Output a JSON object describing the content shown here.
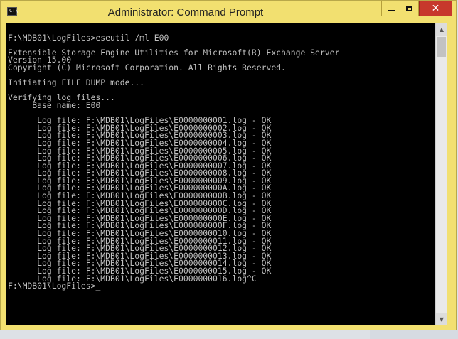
{
  "window": {
    "title": "Administrator: Command Prompt",
    "icon_label": "C:\\"
  },
  "controls": {
    "minimize": "minimize",
    "maximize": "maximize",
    "close": "✕"
  },
  "console_lines": [
    "",
    "F:\\MDB01\\LogFiles>eseutil /ml E00",
    "",
    "Extensible Storage Engine Utilities for Microsoft(R) Exchange Server",
    "Version 15.00",
    "Copyright (C) Microsoft Corporation. All Rights Reserved.",
    "",
    "Initiating FILE DUMP mode...",
    "",
    "Verifying log files...",
    "     Base name: E00",
    "",
    "      Log file: F:\\MDB01\\LogFiles\\E0000000001.log - OK",
    "      Log file: F:\\MDB01\\LogFiles\\E0000000002.log - OK",
    "      Log file: F:\\MDB01\\LogFiles\\E0000000003.log - OK",
    "      Log file: F:\\MDB01\\LogFiles\\E0000000004.log - OK",
    "      Log file: F:\\MDB01\\LogFiles\\E0000000005.log - OK",
    "      Log file: F:\\MDB01\\LogFiles\\E0000000006.log - OK",
    "      Log file: F:\\MDB01\\LogFiles\\E0000000007.log - OK",
    "      Log file: F:\\MDB01\\LogFiles\\E0000000008.log - OK",
    "      Log file: F:\\MDB01\\LogFiles\\E0000000009.log - OK",
    "      Log file: F:\\MDB01\\LogFiles\\E000000000A.log - OK",
    "      Log file: F:\\MDB01\\LogFiles\\E000000000B.log - OK",
    "      Log file: F:\\MDB01\\LogFiles\\E000000000C.log - OK",
    "      Log file: F:\\MDB01\\LogFiles\\E000000000D.log - OK",
    "      Log file: F:\\MDB01\\LogFiles\\E000000000E.log - OK",
    "      Log file: F:\\MDB01\\LogFiles\\E000000000F.log - OK",
    "      Log file: F:\\MDB01\\LogFiles\\E0000000010.log - OK",
    "      Log file: F:\\MDB01\\LogFiles\\E0000000011.log - OK",
    "      Log file: F:\\MDB01\\LogFiles\\E0000000012.log - OK",
    "      Log file: F:\\MDB01\\LogFiles\\E0000000013.log - OK",
    "      Log file: F:\\MDB01\\LogFiles\\E0000000014.log - OK",
    "      Log file: F:\\MDB01\\LogFiles\\E0000000015.log - OK",
    "      Log file: F:\\MDB01\\LogFiles\\E0000000016.log^C"
  ],
  "prompt": "F:\\MDB01\\LogFiles>",
  "cursor": "_",
  "colors": {
    "titlebar": "#f2e070",
    "console_bg": "#000000",
    "console_fg": "#c0c0c0",
    "close_button": "#c7382c"
  },
  "icons": {
    "app": "cmd-icon",
    "minimize": "minimize-icon",
    "maximize": "maximize-icon",
    "close": "close-icon",
    "scroll_up": "arrow-up-icon",
    "scroll_down": "arrow-down-icon"
  }
}
